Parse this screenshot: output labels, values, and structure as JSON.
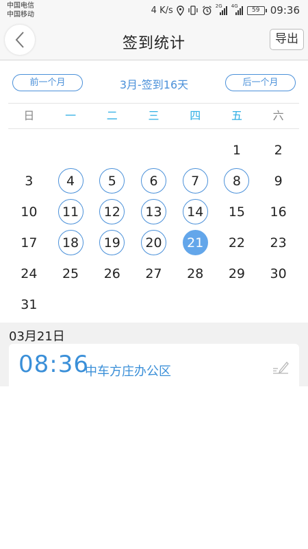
{
  "status_bar": {
    "carrier1": "中国电信",
    "carrier2": "中国移动",
    "speed": "4 K/s",
    "net1": "2G",
    "net2": "4G",
    "battery": "59",
    "time": "09:36"
  },
  "nav": {
    "title": "签到统计",
    "export_label": "导出"
  },
  "month_nav": {
    "prev_label": "前一个月",
    "summary": "3月-签到16天",
    "next_label": "后一个月"
  },
  "weekdays": [
    "日",
    "一",
    "二",
    "三",
    "四",
    "五",
    "六"
  ],
  "calendar": {
    "leading_blanks": 5,
    "days": [
      "1",
      "2",
      "3",
      "4",
      "5",
      "6",
      "7",
      "8",
      "9",
      "10",
      "11",
      "12",
      "13",
      "14",
      "15",
      "16",
      "17",
      "18",
      "19",
      "20",
      "21",
      "22",
      "23",
      "24",
      "25",
      "26",
      "27",
      "28",
      "29",
      "30",
      "31"
    ],
    "signed_days": [
      4,
      5,
      6,
      7,
      8,
      11,
      12,
      13,
      14,
      18,
      19,
      20
    ],
    "selected_day": 21
  },
  "detail": {
    "date": "03月21日",
    "records": [
      {
        "time": "08:36",
        "location": "中车方庄办公区"
      }
    ]
  },
  "colors": {
    "accent": "#4a90d9",
    "selected_fill": "#63a6ea",
    "weekday_text": "#2eaee4"
  },
  "icons": [
    "chevron-left-icon",
    "location-icon",
    "vibrate-icon",
    "alarm-icon",
    "signal-icon",
    "battery-icon",
    "edit-icon"
  ]
}
